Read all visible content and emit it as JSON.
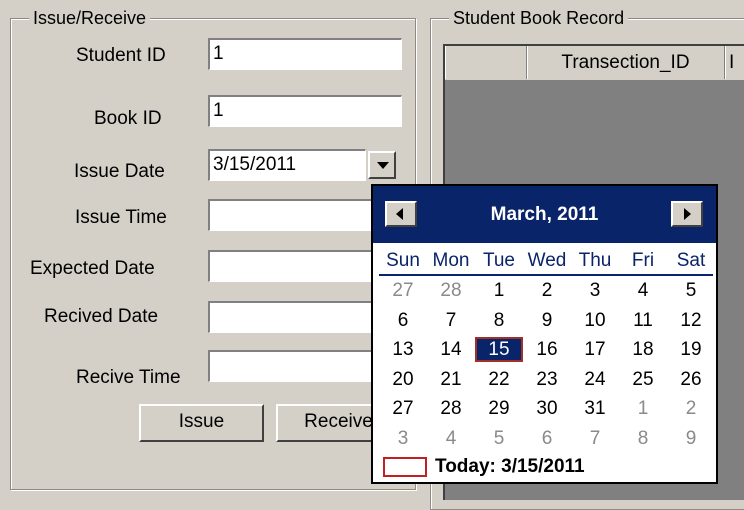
{
  "issue_panel": {
    "legend": "Issue/Receive",
    "student_id_label": "Student ID",
    "student_id_value": "1",
    "book_id_label": "Book ID",
    "book_id_value": "1",
    "issue_date_label": "Issue Date",
    "issue_date_value": "3/15/2011",
    "issue_time_label": "Issue Time",
    "issue_time_value": "",
    "expected_date_label": "Expected Date",
    "expected_date_value": "",
    "recived_date_label": "Recived Date",
    "recived_date_value": "",
    "recive_time_label": "Recive Time",
    "recive_time_value": "",
    "issue_button": "Issue",
    "receive_button": "Receive"
  },
  "record_panel": {
    "legend": "Student Book Record",
    "columns": [
      "Transection_ID",
      "I"
    ]
  },
  "calendar": {
    "month_title": "March, 2011",
    "weekdays": [
      "Sun",
      "Mon",
      "Tue",
      "Wed",
      "Thu",
      "Fri",
      "Sat"
    ],
    "weeks": [
      [
        "27",
        "28",
        "1",
        "2",
        "3",
        "4",
        "5"
      ],
      [
        "6",
        "7",
        "8",
        "9",
        "10",
        "11",
        "12"
      ],
      [
        "13",
        "14",
        "15",
        "16",
        "17",
        "18",
        "19"
      ],
      [
        "20",
        "21",
        "22",
        "23",
        "24",
        "25",
        "26"
      ],
      [
        "27",
        "28",
        "29",
        "30",
        "31",
        "1",
        "2"
      ],
      [
        "3",
        "4",
        "5",
        "6",
        "7",
        "8",
        "9"
      ]
    ],
    "other_month": [
      [
        true,
        true,
        false,
        false,
        false,
        false,
        false
      ],
      [
        false,
        false,
        false,
        false,
        false,
        false,
        false
      ],
      [
        false,
        false,
        false,
        false,
        false,
        false,
        false
      ],
      [
        false,
        false,
        false,
        false,
        false,
        false,
        false
      ],
      [
        false,
        false,
        false,
        false,
        false,
        true,
        true
      ],
      [
        true,
        true,
        true,
        true,
        true,
        true,
        true
      ]
    ],
    "selected_day": "15",
    "today_text": "Today: 3/15/2011"
  },
  "colors": {
    "window_bg": "#d4d0c8",
    "calendar_title_bg": "#0a246a",
    "selected_day_bg": "#0a246a",
    "today_marker": "#c02020",
    "grid_bg": "#808080"
  }
}
